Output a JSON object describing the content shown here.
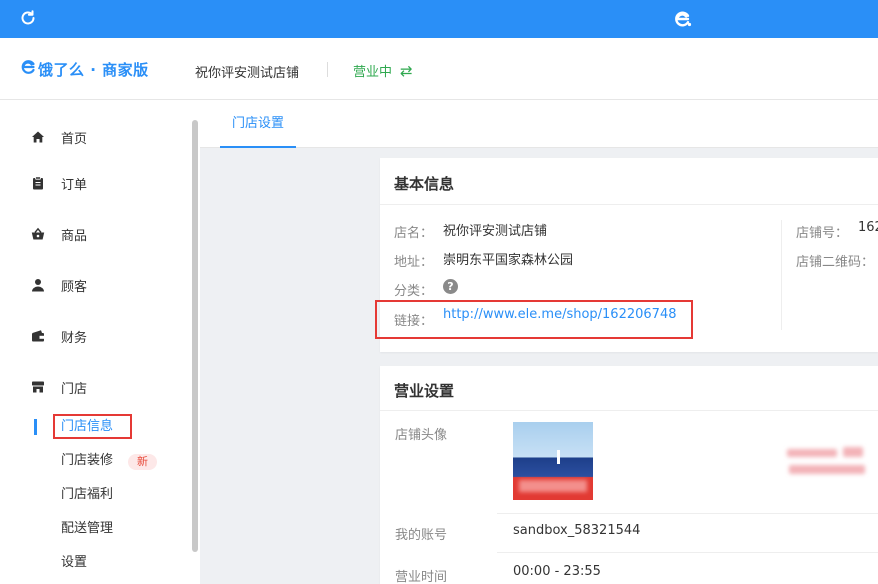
{
  "brand": {
    "logo_text": "饿了么 · 商家版"
  },
  "header": {
    "shop_name": "祝你评安测试店铺",
    "status": "营业中"
  },
  "sidebar": {
    "items": [
      {
        "label": "首页",
        "icon": "home-icon"
      },
      {
        "label": "订单",
        "icon": "clipboard-icon"
      },
      {
        "label": "商品",
        "icon": "basket-icon"
      },
      {
        "label": "顾客",
        "icon": "user-icon"
      },
      {
        "label": "财务",
        "icon": "wallet-icon"
      },
      {
        "label": "门店",
        "icon": "store-icon"
      }
    ],
    "sub_items": [
      {
        "label": "门店信息",
        "active": true
      },
      {
        "label": "门店装修"
      },
      {
        "label": "门店福利"
      },
      {
        "label": "配送管理"
      },
      {
        "label": "设置"
      }
    ],
    "new_badge": "新"
  },
  "tabs": [
    {
      "label": "门店设置",
      "active": true
    }
  ],
  "basic_info": {
    "title": "基本信息",
    "name_label": "店名：",
    "name_value": "祝你评安测试店铺",
    "address_label": "地址：",
    "address_value": "崇明东平国家森林公园",
    "category_label": "分类：",
    "category_help": "?",
    "link_label": "链接：",
    "link_value": "http://www.ele.me/shop/162206748",
    "shop_no_label": "店铺号：",
    "shop_no_value": "162",
    "qr_label": "店铺二维码："
  },
  "business_settings": {
    "title": "营业设置",
    "avatar_label": "店铺头像",
    "account_label": "我的账号",
    "account_value": "sandbox_58321544",
    "hours_label": "营业时间",
    "hours_value": "00:00 - 23:55"
  },
  "colors": {
    "accent": "#2a8ff7",
    "status_green": "#2fa84f",
    "highlight_red": "#e53935"
  }
}
